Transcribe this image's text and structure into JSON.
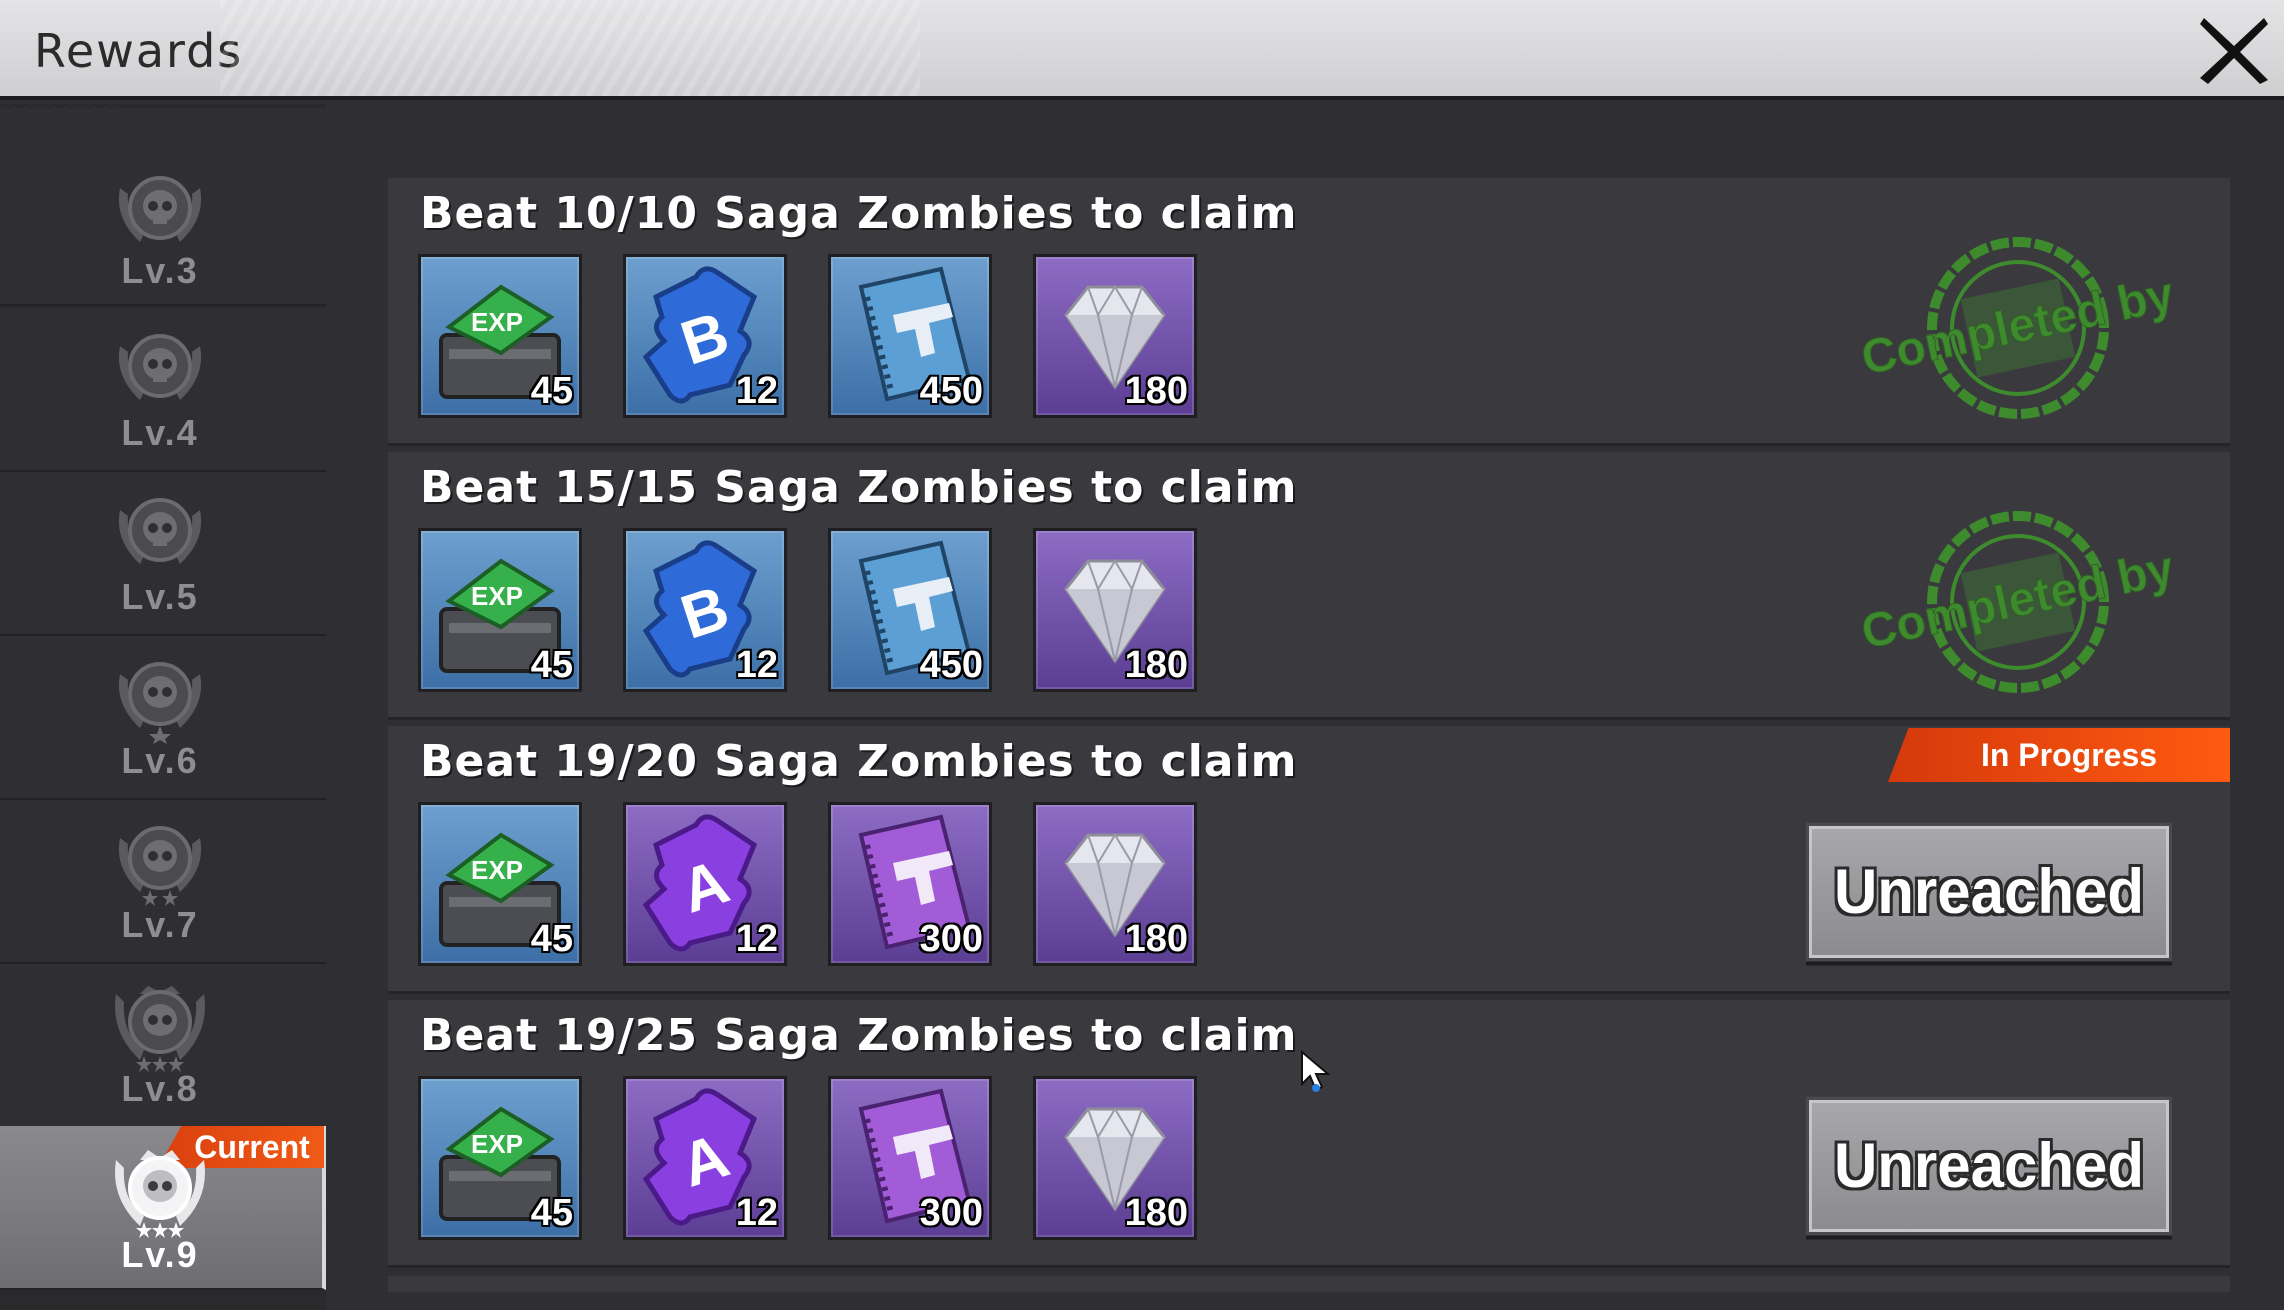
{
  "header": {
    "title": "Rewards",
    "close_icon": "close-icon"
  },
  "sidebar": {
    "levels": [
      {
        "label": "Lv.3"
      },
      {
        "label": "Lv.4"
      },
      {
        "label": "Lv.5"
      },
      {
        "label": "Lv.6"
      },
      {
        "label": "Lv.7"
      },
      {
        "label": "Lv.8"
      },
      {
        "label": "Lv.9",
        "tag": "Current"
      }
    ],
    "current_index": 6
  },
  "rewards": [
    {
      "title": "Beat 10/10 Saga Zombies to claim",
      "items": [
        {
          "icon": "exp-chest-icon",
          "qty": "45"
        },
        {
          "icon": "puzzle-b-icon",
          "qty": "12"
        },
        {
          "icon": "pistol-manual-blue-icon",
          "qty": "450"
        },
        {
          "icon": "diamond-icon",
          "qty": "180"
        }
      ],
      "stamp_text": "Completed by"
    },
    {
      "title": "Beat 15/15 Saga Zombies to claim",
      "items": [
        {
          "icon": "exp-chest-icon",
          "qty": "45"
        },
        {
          "icon": "puzzle-b-icon",
          "qty": "12"
        },
        {
          "icon": "pistol-manual-blue-icon",
          "qty": "450"
        },
        {
          "icon": "diamond-icon",
          "qty": "180"
        }
      ],
      "stamp_text": "Completed by"
    },
    {
      "title": "Beat 19/20 Saga Zombies to claim",
      "items": [
        {
          "icon": "exp-chest-icon",
          "qty": "45"
        },
        {
          "icon": "puzzle-a-icon",
          "qty": "12"
        },
        {
          "icon": "pistol-manual-purple-icon",
          "qty": "300"
        },
        {
          "icon": "diamond-icon",
          "qty": "180"
        }
      ],
      "status_tag": "In Progress",
      "button_label": "Unreached"
    },
    {
      "title": "Beat 19/25 Saga Zombies to claim",
      "items": [
        {
          "icon": "exp-chest-icon",
          "qty": "45"
        },
        {
          "icon": "puzzle-a-icon",
          "qty": "12"
        },
        {
          "icon": "pistol-manual-purple-icon",
          "qty": "300"
        },
        {
          "icon": "diamond-icon",
          "qty": "180"
        }
      ],
      "button_label": "Unreached"
    }
  ],
  "colors": {
    "accent_orange": "#f05a16",
    "stamp_green": "#3f9a2b",
    "panel": "#3a3a3e"
  }
}
